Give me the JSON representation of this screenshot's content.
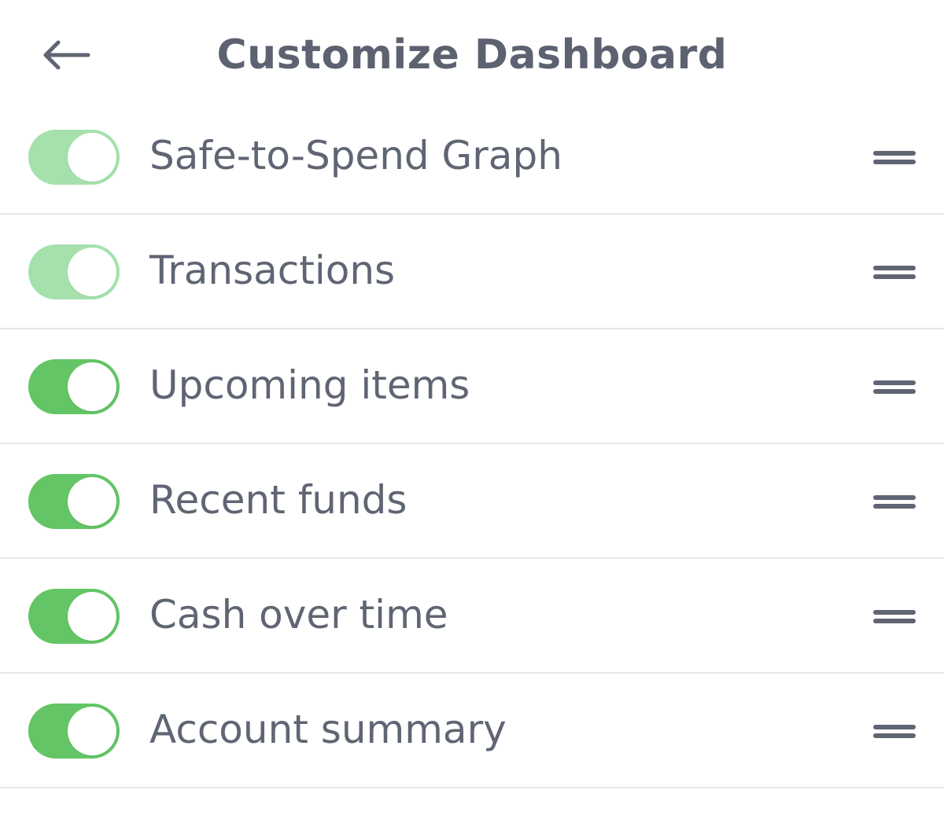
{
  "header": {
    "title": "Customize Dashboard",
    "back_icon": "arrow-left-icon"
  },
  "colors": {
    "toggle_on": "#63c565",
    "toggle_on_faded": "#a6e1ad",
    "text": "#5f6573",
    "divider": "#e7e8ec"
  },
  "items": [
    {
      "label": "Safe-to-Spend Graph",
      "enabled": true,
      "style": "faded"
    },
    {
      "label": "Transactions",
      "enabled": true,
      "style": "faded"
    },
    {
      "label": "Upcoming items",
      "enabled": true,
      "style": "solid"
    },
    {
      "label": "Recent funds",
      "enabled": true,
      "style": "solid"
    },
    {
      "label": "Cash over time",
      "enabled": true,
      "style": "solid"
    },
    {
      "label": "Account summary",
      "enabled": true,
      "style": "solid"
    }
  ]
}
